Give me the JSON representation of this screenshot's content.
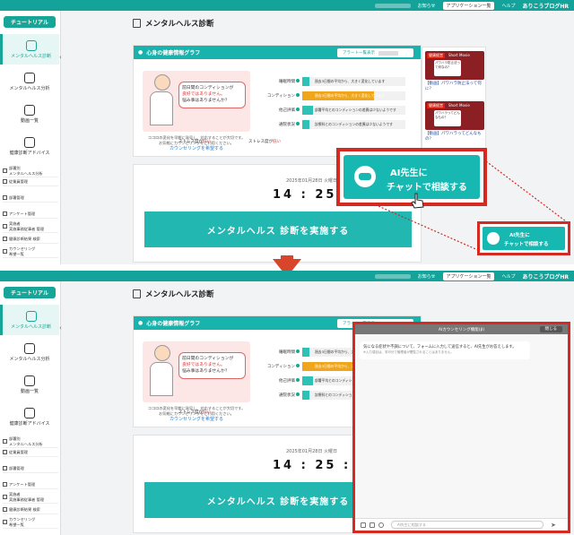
{
  "topbar": {
    "notice": "お知らせ",
    "apps": "アプリケーション一覧",
    "help": "ヘルプ",
    "brand": "ありこうブログHR"
  },
  "sidebar": {
    "tutorial": "チュートリアル",
    "items": [
      "メンタルヘルス診断",
      "メンタルヘルス分析",
      "動画一覧",
      "健康診断アドバイス"
    ],
    "small_items": [
      "部署別\nメンタルヘルス分析",
      "従業員管理",
      "部署管理",
      "アンケート管理",
      "実施者\n実施事務従事者 管理",
      "健康診断結果 検索",
      "カウンセリング\n希望一覧"
    ]
  },
  "page": {
    "title": "メンタルヘルス診断"
  },
  "card": {
    "title": "心身の健康情報グラフ",
    "alert_btn": "アラート一覧表示",
    "bubble": [
      "前日間のコンディションが",
      "良好ではありません。",
      "悩み事はありませんか？"
    ],
    "note": "ココロの変化を早期に発見し、対応することが大切です。\nお気軽にカウンセリングをご利用ください。",
    "link": "カウンセリングを希望する",
    "stats": [
      {
        "label": "睡眠時間",
        "text": "過去3日間の平均から、大きく変化しています",
        "color": "#2ec1b5"
      },
      {
        "label": "コンディション",
        "text": "過去3日間の平均から、大きく変化しています",
        "color": "#f0a61c"
      },
      {
        "label": "他己評価",
        "text": "部署平均とのコンディションの差異は少ないようです",
        "color": "#2ec1b5"
      },
      {
        "label": "通院状況",
        "text": "診療科とのコンディションの差異は少ないようです",
        "color": "#2ec1b5"
      }
    ],
    "stress_label": "ストレス度が",
    "stress_value": "低い",
    "stress2": "ストレス度が",
    "stress2_value": "低い"
  },
  "shorts": [
    {
      "tag": "健康経営",
      "badge": "Short Movie",
      "inner": "パワハラ防止法って何なの？",
      "caption": "【動画】パワハラ防止法って何に？"
    },
    {
      "tag": "健康経営",
      "badge": "Short Movie",
      "inner": "パワハラってどんなもの？",
      "caption": "【動画】パワハラってどんなもの？"
    }
  ],
  "timer": {
    "date": "2025年01月28日 火曜日",
    "time": "14 : 25 : 00",
    "run": "メンタルヘルス 診断を実施する"
  },
  "ai": {
    "line1": "AI先生に",
    "line2": "チャットで相談する"
  },
  "chat": {
    "title": "AIカウンセリング機能(β)",
    "close": "閉じる",
    "message": "気になる症状や不調について、フォームに入力して送信すると、AI先生がお答えします。",
    "sub": "※入力項目は、非可分で管理者が閲覧されることはありません。",
    "placeholder": "AI先生に相談する"
  }
}
